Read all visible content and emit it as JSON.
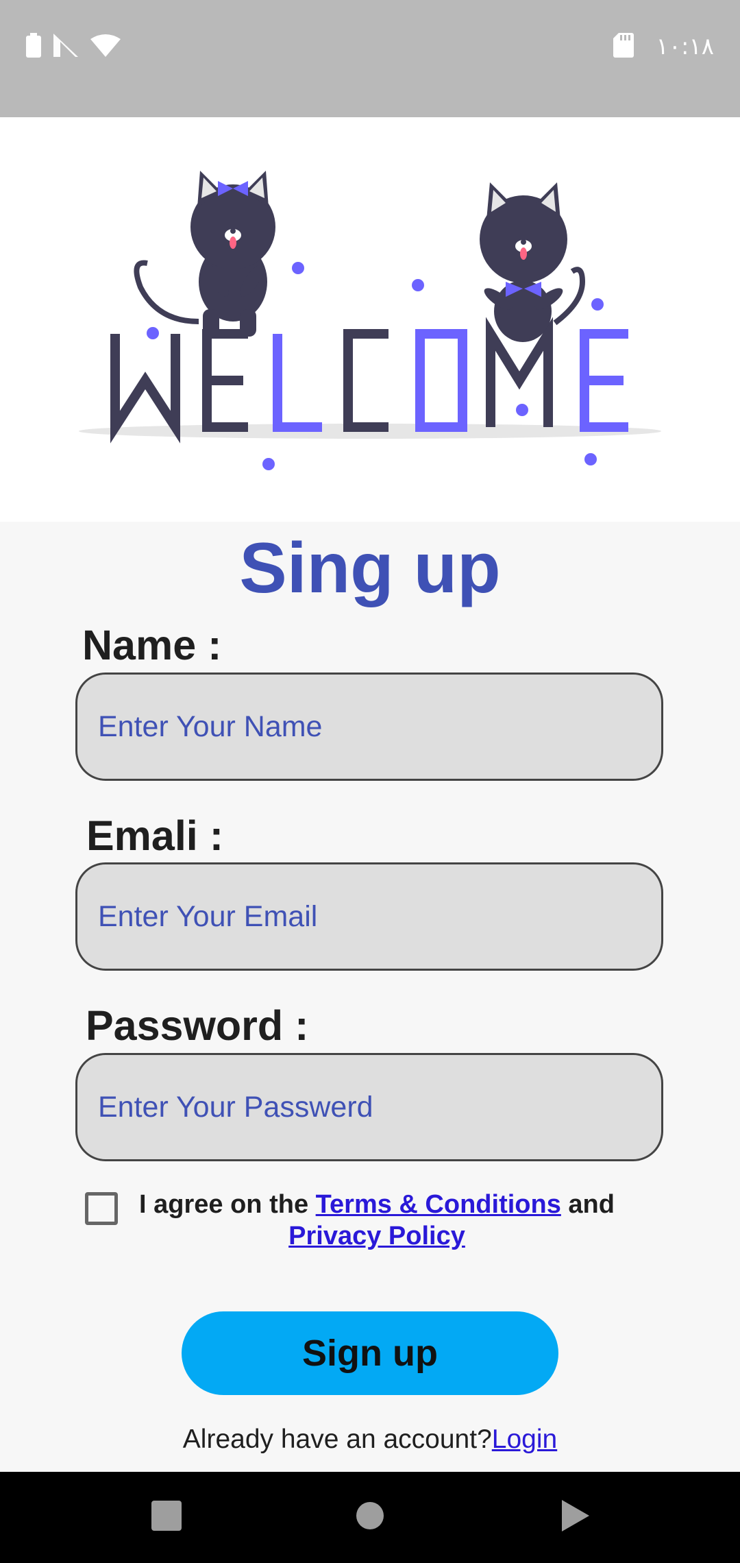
{
  "status_bar": {
    "time": "١٠:١٨",
    "icons": [
      "battery-icon",
      "signal-icon",
      "wifi-icon",
      "sd-card-icon"
    ]
  },
  "hero": {
    "word": "WELCOME",
    "colors": {
      "dark": "#3f3d56",
      "accent": "#6c63ff",
      "shadow": "#e6e6e6"
    }
  },
  "form": {
    "title": "Sing up",
    "name_label": "Name :",
    "name_placeholder": "Enter Your Name",
    "email_label": "Emali :",
    "email_placeholder": "Enter Your Email",
    "password_label": "Password :",
    "password_placeholder": "Enter Your Passwerd",
    "agree_prefix": "I agree on the ",
    "terms_link": "Terms & Conditions",
    "agree_and": " and",
    "privacy_link": "Privacy Policy",
    "signup_button": "Sign up",
    "account_text": "Already have an account?",
    "login_link": "Login",
    "colors": {
      "title": "#3f51b5",
      "button": "#03a9f4",
      "link": "#2a19d8"
    }
  },
  "nav_bar": {
    "icons": [
      "recent-apps-icon",
      "home-icon",
      "back-icon"
    ]
  }
}
